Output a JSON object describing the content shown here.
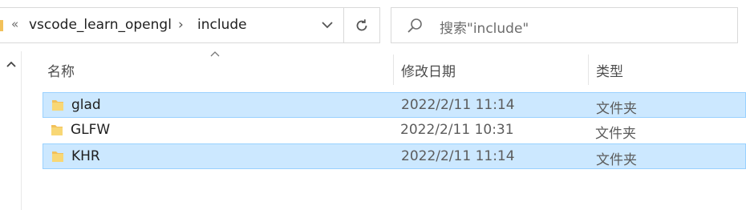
{
  "address_bar": {
    "overflow_symbol": "«",
    "breadcrumbs": [
      "vscode_learn_opengl",
      "include"
    ],
    "separator_symbol": "›"
  },
  "search": {
    "placeholder": "搜索\"include\""
  },
  "columns": {
    "name": "名称",
    "modified": "修改日期",
    "type": "类型"
  },
  "files": [
    {
      "name": "glad",
      "modified": "2022/2/11 11:14",
      "type": "文件夹",
      "selected": true
    },
    {
      "name": "GLFW",
      "modified": "2022/2/11 10:31",
      "type": "文件夹",
      "selected": false
    },
    {
      "name": "KHR",
      "modified": "2022/2/11 11:14",
      "type": "文件夹",
      "selected": true
    }
  ],
  "colors": {
    "selection_fill": "#cce8ff",
    "selection_border": "#99d1ff",
    "folder": "#f2c15a"
  },
  "icons": [
    "folder-icon",
    "chevron-down-icon",
    "refresh-icon",
    "search-icon",
    "sort-up-icon",
    "scroll-up-icon"
  ]
}
